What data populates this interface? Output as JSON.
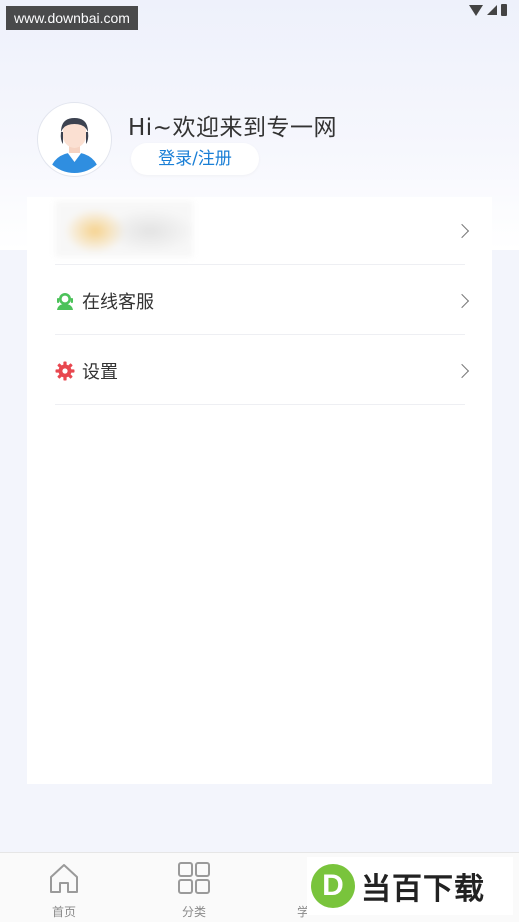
{
  "watermark": {
    "top_text": "www.downbai.com",
    "brand_letter": "D",
    "brand_text": "当百下载"
  },
  "profile": {
    "greeting": "Hi~欢迎来到专一网",
    "login_label": "登录/注册"
  },
  "menu": {
    "items": [
      {
        "label": "",
        "icon": "blurred-promo"
      },
      {
        "label": "在线客服",
        "icon": "customer-service-icon"
      },
      {
        "label": "设置",
        "icon": "gear-icon"
      }
    ]
  },
  "tabbar": {
    "tabs": [
      {
        "label": "首页",
        "icon": "home-icon"
      },
      {
        "label": "分类",
        "icon": "grid-icon"
      },
      {
        "label": "学",
        "icon": "study-icon"
      }
    ]
  },
  "colors": {
    "accent": "#1a7fd6",
    "service_icon": "#4cc25a",
    "gear_icon": "#e8474f"
  }
}
